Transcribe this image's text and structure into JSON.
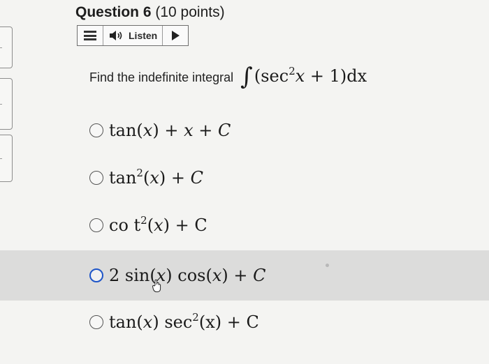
{
  "question": {
    "label": "Question 6",
    "points": "(10 points)"
  },
  "listen_widget": {
    "label": "Listen",
    "icons": [
      "menu-icon",
      "speaker-icon",
      "play-icon"
    ]
  },
  "prompt": {
    "text": "Find the indefinite integral",
    "integral_symbol": "∫",
    "integrand_open": "(sec",
    "integrand_exp": "2",
    "integrand_var": "x",
    "integrand_rest": " + 1)dx"
  },
  "options": [
    {
      "id": "a",
      "selected": false,
      "highlighted": false
    },
    {
      "id": "b",
      "selected": false,
      "highlighted": false
    },
    {
      "id": "c",
      "selected": false,
      "highlighted": false
    },
    {
      "id": "d",
      "selected": false,
      "highlighted": true
    },
    {
      "id": "e",
      "selected": false,
      "highlighted": false
    }
  ],
  "option_text": {
    "a": {
      "p1": "tan(",
      "v1": "x",
      "p2": ") + ",
      "v2": "x",
      "p3": " + ",
      "v3": "C"
    },
    "b": {
      "p1": "tan",
      "exp": "2",
      "p2": "(",
      "v1": "x",
      "p3": ") + ",
      "v2": "C"
    },
    "c": {
      "p1": "co t",
      "exp": "2",
      "p2": "(",
      "v1": "x",
      "p3": ") + C"
    },
    "d": {
      "p1": "2 sin(",
      "v1": "x",
      "p2": ") cos(",
      "v2": "x",
      "p3": ") + ",
      "v3": "C"
    },
    "e": {
      "p1": "tan(",
      "v1": "x",
      "p2": ") sec",
      "exp": "2",
      "p3": "(x) + C"
    }
  },
  "colors": {
    "highlight_row": "#dcdcdb",
    "focused_radio": "#1e55c8",
    "background": "#f4f4f2"
  }
}
